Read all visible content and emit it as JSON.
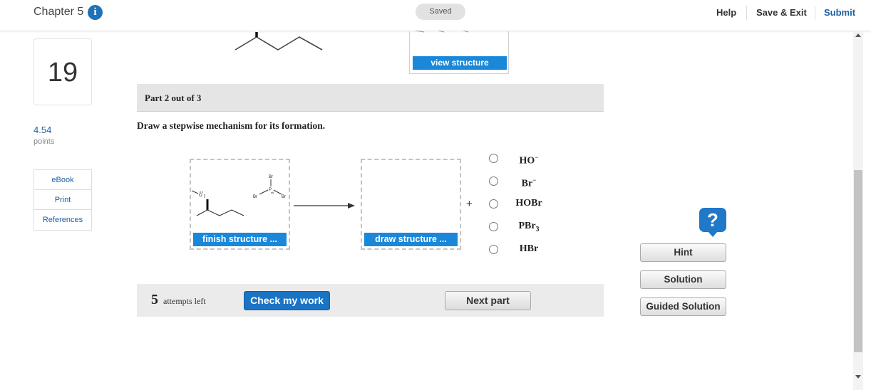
{
  "header": {
    "chapter": "Chapter 5",
    "info_icon": "info-icon",
    "saved_status": "Saved",
    "help_label": "Help",
    "save_exit_label": "Save & Exit",
    "submit_label": "Submit"
  },
  "question": {
    "number": "19",
    "points_value": "4.54",
    "points_label": "points"
  },
  "side_menu": {
    "items": [
      {
        "label": "eBook"
      },
      {
        "label": "Print"
      },
      {
        "label": "References"
      }
    ]
  },
  "previous_part": {
    "view_structure_label": "view structure"
  },
  "part": {
    "title": "Part 2 out of 3",
    "instruction": "Draw a stepwise mechanism for its formation."
  },
  "mechanism": {
    "reactant_atom_labels": {
      "br_top": "Br",
      "p": "P",
      "br_left": "Br",
      "br_right": "Br",
      "h": "H",
      "o": "O"
    },
    "finish_structure_label": "finish structure ...",
    "draw_structure_label": "draw structure ...",
    "plus_sign": "+",
    "byproduct_options": [
      {
        "base": "HO",
        "sup": "−",
        "sub": ""
      },
      {
        "base": "Br",
        "sup": "−",
        "sub": ""
      },
      {
        "base": "HOBr",
        "sup": "",
        "sub": ""
      },
      {
        "base": "PBr",
        "sup": "",
        "sub": "3"
      },
      {
        "base": "HBr",
        "sup": "",
        "sub": ""
      }
    ]
  },
  "footer": {
    "attempts_count": "5",
    "attempts_label": "attempts left",
    "check_label": "Check my work",
    "next_label": "Next part"
  },
  "helpers": {
    "help_icon": "question-mark-icon",
    "hint_label": "Hint",
    "solution_label": "Solution",
    "guided_solution_label": "Guided Solution"
  },
  "colors": {
    "accent_blue": "#1a87d9",
    "dark_blue": "#1a73c4",
    "header_gray": "#e5e5e5"
  }
}
